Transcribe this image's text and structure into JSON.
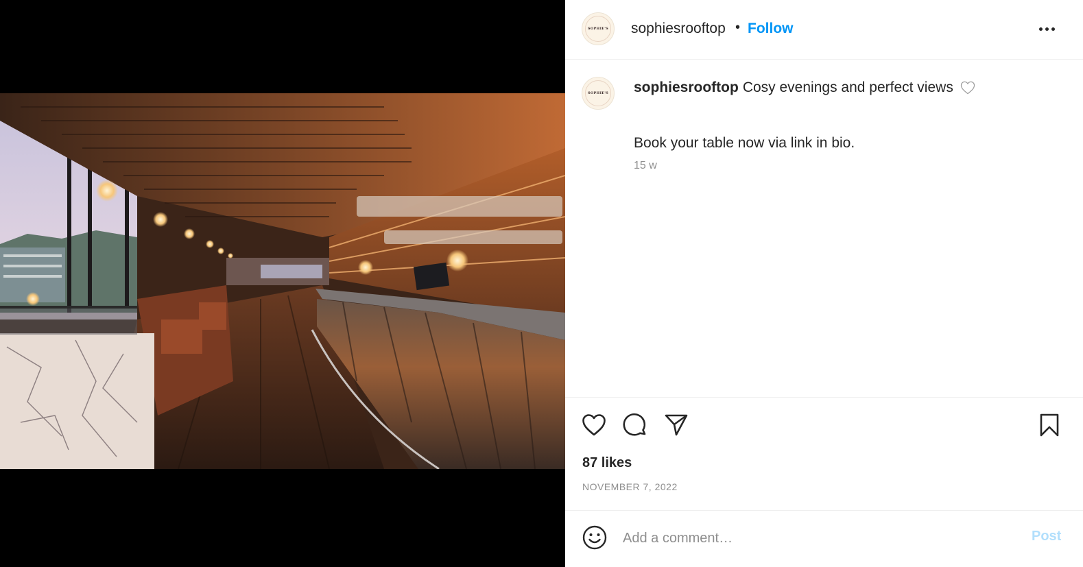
{
  "post": {
    "author": "sophiesrooftop",
    "avatar_brand": "SOPHIE'S",
    "follow_label": "Follow",
    "separator": "•",
    "more_icon": "more-horizontal-icon",
    "caption_text": "Cosy evenings and perfect views",
    "caption_line2": "Book your table now via link in bio.",
    "time_ago": "15 w",
    "likes": "87 likes",
    "date": "NOVEMBER 7, 2022"
  },
  "actions": {
    "like_icon": "heart-icon",
    "comment_icon": "comment-icon",
    "share_icon": "send-icon",
    "save_icon": "bookmark-icon"
  },
  "comment_box": {
    "placeholder": "Add a comment…",
    "post_label": "Post",
    "emoji_icon": "emoji-icon"
  },
  "colors": {
    "follow_blue": "#0095f6",
    "post_disabled": "#b2dffc",
    "muted": "#8e8e8e"
  }
}
